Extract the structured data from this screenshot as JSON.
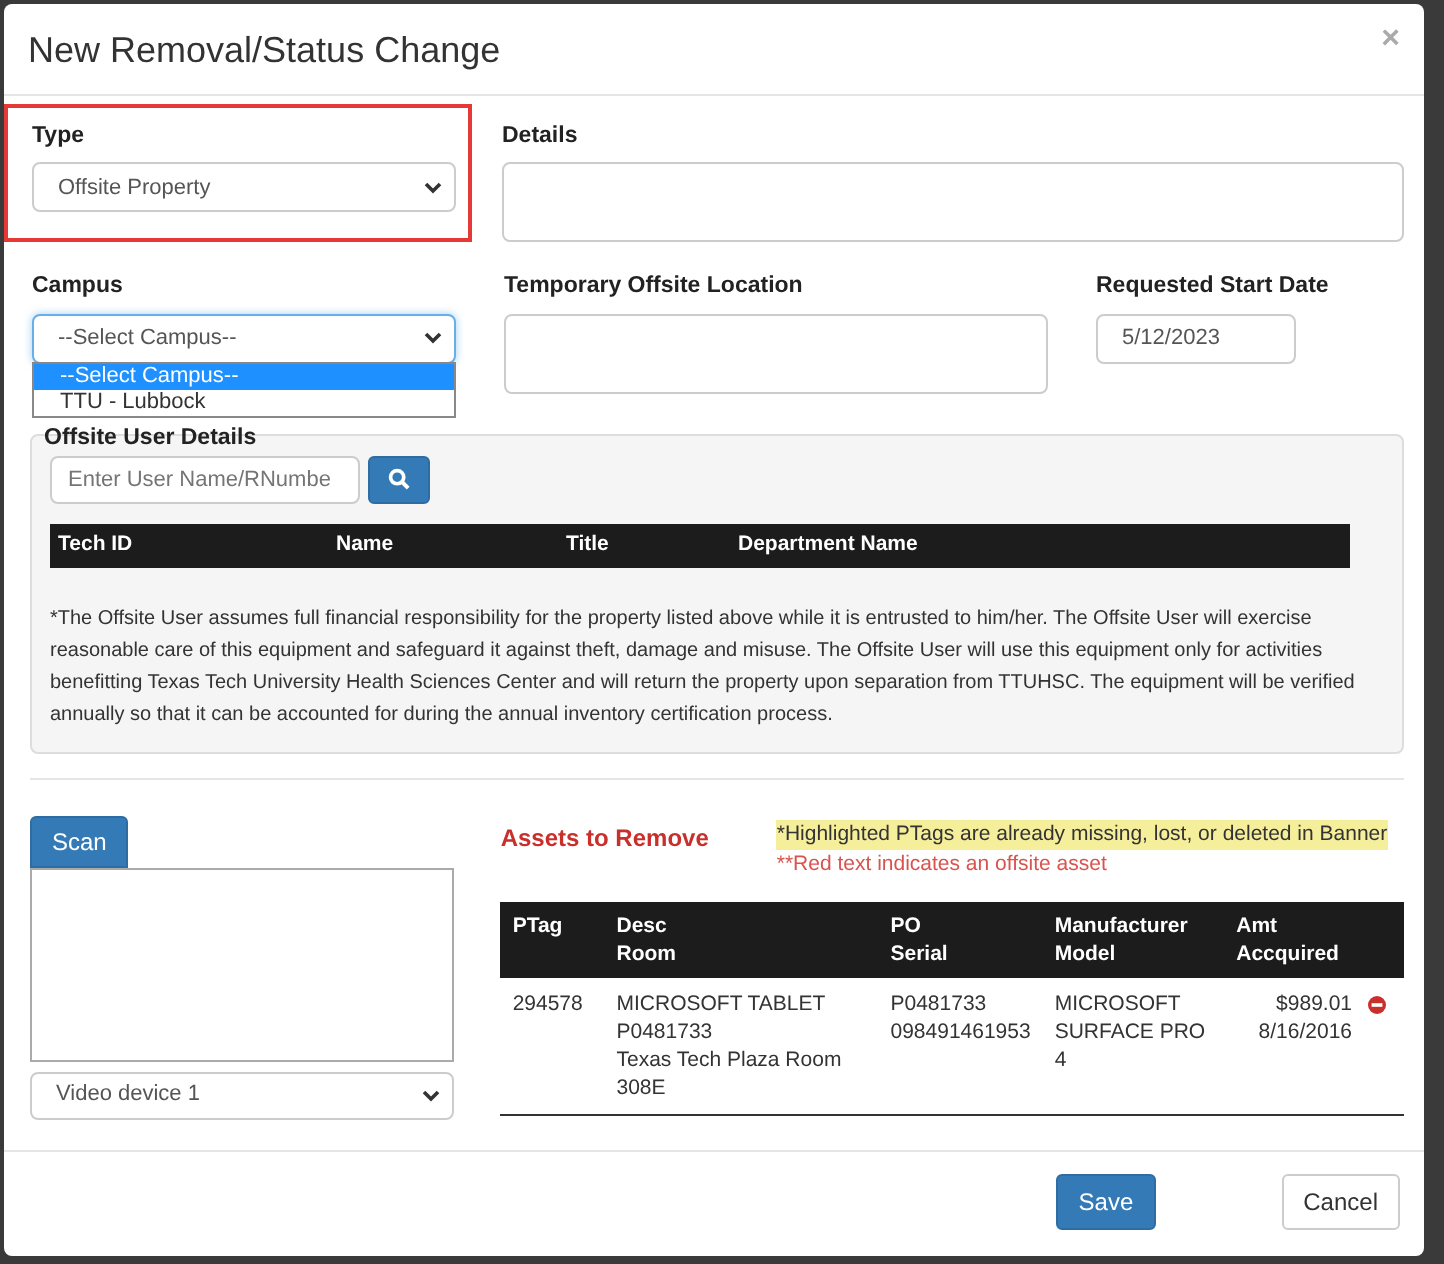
{
  "dialog": {
    "title": "New Removal/Status Change",
    "close": "×"
  },
  "type_field": {
    "label": "Type",
    "value": "Offsite Property",
    "highlighted": true
  },
  "details": {
    "label": "Details"
  },
  "campus": {
    "label": "Campus",
    "value": "--Select Campus--",
    "expanded": true,
    "options": [
      {
        "label": "--Select Campus--",
        "selected": true
      },
      {
        "label": "TTU - Lubbock",
        "selected": false
      }
    ]
  },
  "temporary_location": {
    "label": "Temporary Offsite Location"
  },
  "start_date": {
    "label": "Requested Start Date",
    "value": "5/12/2023"
  },
  "offsite_user": {
    "legend": "Offsite User Details",
    "search": {
      "placeholder": "Enter User Name/RNumbe"
    },
    "columns": [
      "Tech ID",
      "Name",
      "Title",
      "Department Name"
    ],
    "disclaimer": "*The Offsite User assumes full financial responsibility for the property listed above while it is entrusted to him/her. The Offsite User will exercise reasonable care of this equipment and safeguard it against theft, damage and misuse. The Offsite User will use this equipment only for activities benefitting Texas Tech University Health Sciences Center and will return the property upon separation from TTUHSC. The equipment will be verified annually so that it can be accounted for during the annual inventory certification process."
  },
  "scanner": {
    "button": "Scan",
    "device": "Video device 1"
  },
  "assets": {
    "title": "Assets to Remove",
    "notes": [
      {
        "kind": "highlight",
        "text": "*Highlighted PTags are already missing, lost, or deleted in Banner"
      },
      {
        "kind": "red",
        "text": "**Red text indicates an offsite asset"
      }
    ],
    "columns": [
      "PTag",
      "Desc\nRoom",
      "PO\nSerial",
      "Manufacturer\nModel",
      "Amt\nAccquired"
    ],
    "rows": [
      {
        "cells": [
          "294578",
          "MICROSOFT TABLET\nP0481733\nTexas Tech Plaza Room 308E",
          "P0481733\n098491461953",
          "MICROSOFT SURFACE PRO 4",
          "$989.01\n8/16/2016"
        ]
      }
    ]
  },
  "buttons": [
    {
      "label": "Save",
      "kind": "primary"
    },
    {
      "label": "Cancel",
      "kind": "default"
    }
  ]
}
